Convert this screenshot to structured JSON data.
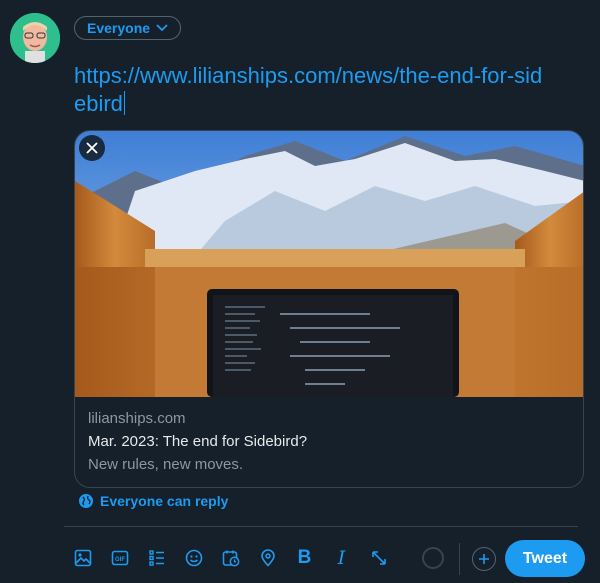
{
  "audience": {
    "label": "Everyone"
  },
  "composer": {
    "url_text": "https://www.lilianships.com/news/the-end-for-sidebird"
  },
  "card": {
    "domain": "lilianships.com",
    "title": "Mar. 2023: The end for Sidebird?",
    "description": "New rules, new moves."
  },
  "reply_setting": {
    "label": "Everyone can reply"
  },
  "toolbar": {
    "icons": [
      "image-icon",
      "gif-icon",
      "poll-icon",
      "emoji-icon",
      "schedule-icon",
      "location-icon",
      "bold-icon",
      "italic-icon",
      "expand-icon"
    ],
    "bold_glyph": "B",
    "italic_glyph": "I"
  },
  "tweet_button": {
    "label": "Tweet"
  },
  "colors": {
    "accent": "#1d9bf0",
    "background": "#15202b",
    "border": "#38444d",
    "muted": "#8b98a5"
  }
}
